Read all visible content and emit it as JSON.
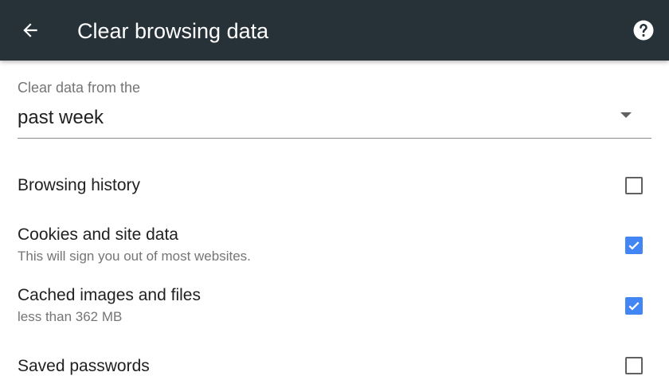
{
  "appbar": {
    "title": "Clear browsing data",
    "back_icon": "arrow-back-icon",
    "help_icon": "help-circle-icon",
    "background_color": "#263238"
  },
  "time_range": {
    "label": "Clear data from the",
    "selected": "past week"
  },
  "items": [
    {
      "title": "Browsing history",
      "subtitle": "",
      "checked": false
    },
    {
      "title": "Cookies and site data",
      "subtitle": "This will sign you out of most websites.",
      "checked": true
    },
    {
      "title": "Cached images and files",
      "subtitle": "less than 362 MB",
      "checked": true
    },
    {
      "title": "Saved passwords",
      "subtitle": "",
      "checked": false
    }
  ],
  "colors": {
    "accent": "#4285f4"
  }
}
